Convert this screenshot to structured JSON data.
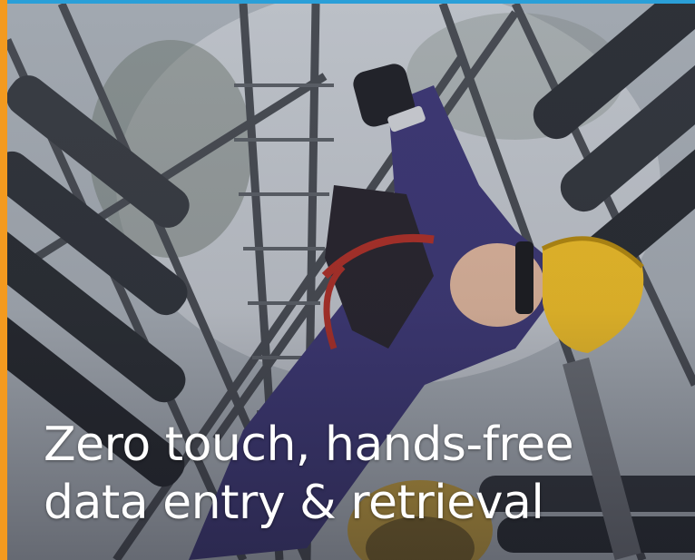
{
  "tile": {
    "caption_line1": "Zero touch, hands-free",
    "caption_line2": "data entry & retrieval"
  },
  "colors": {
    "top_accent": "#2a9fd8",
    "left_accent": "#f39a1f",
    "caption_text": "#ffffff"
  }
}
